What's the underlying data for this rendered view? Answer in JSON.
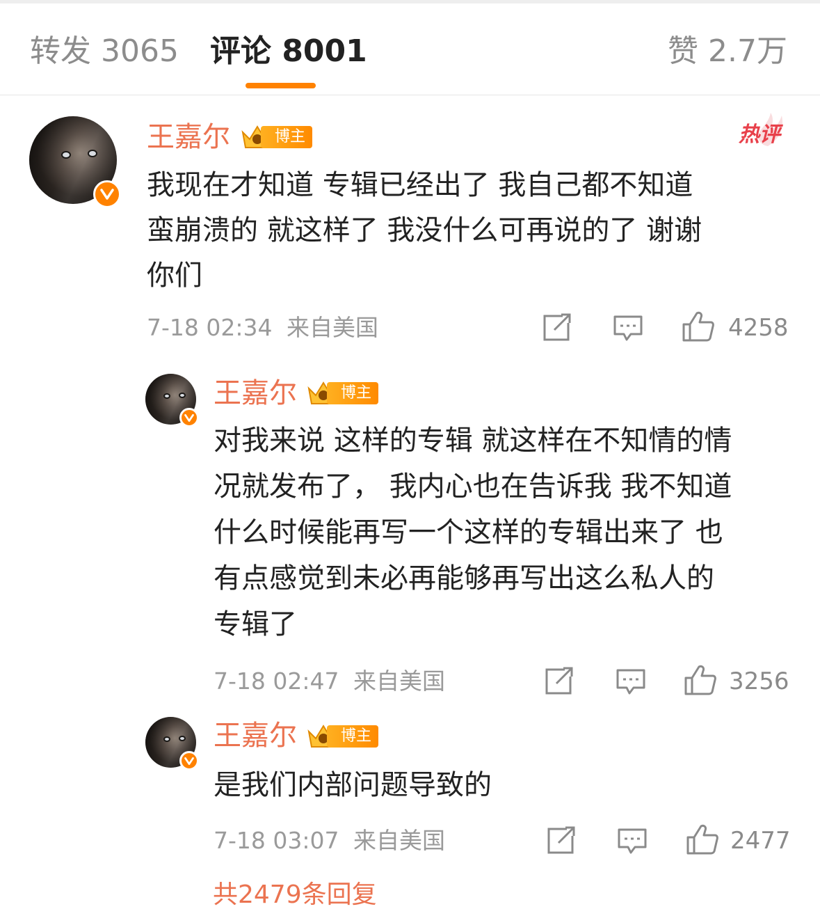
{
  "tabs": {
    "repost": "转发 3065",
    "comments": "评论 8001",
    "likes": "赞 2.7万"
  },
  "colors": {
    "accent": "#ff8200",
    "username": "#eb7350",
    "hot": "#e8404a"
  },
  "hot_badge": "热评",
  "comments": [
    {
      "username": "王嘉尔",
      "badge": "博主",
      "text": "我现在才知道 专辑已经出了 我自己都不知道\n蛮崩溃的  就这样了 我没什么可再说的了  谢谢\n你们",
      "time": "7-18 02:34",
      "location": "来自美国",
      "likes": "4258"
    },
    {
      "username": "王嘉尔",
      "badge": "博主",
      "text": "对我来说 这样的专辑 就这样在不知情的情\n况就发布了，  我内心也在告诉我 我不知道\n什么时候能再写一个这样的专辑出来了 也\n有点感觉到未必再能够再写出这么私人的\n专辑了",
      "time": "7-18 02:47",
      "location": "来自美国",
      "likes": "3256"
    },
    {
      "username": "王嘉尔",
      "badge": "博主",
      "text": "是我们内部问题导致的",
      "time": "7-18 03:07",
      "location": "来自美国",
      "likes": "2477"
    }
  ],
  "more_replies": "共2479条回复",
  "icons": [
    "verified-icon",
    "crown-icon",
    "repost-icon",
    "comment-icon",
    "like-icon"
  ]
}
